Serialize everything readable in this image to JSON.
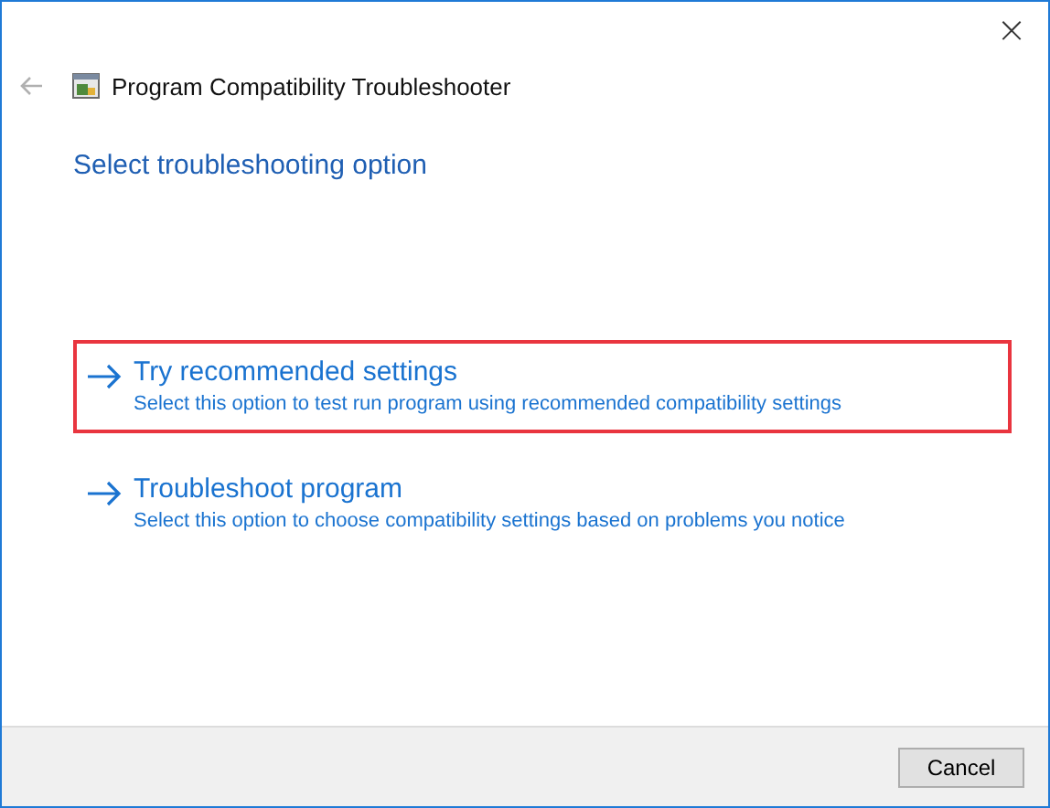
{
  "window": {
    "title": "Program Compatibility Troubleshooter",
    "close": "×"
  },
  "heading": "Select troubleshooting option",
  "options": [
    {
      "title": "Try recommended settings",
      "description": "Select this option to test run program using recommended compatibility settings",
      "highlighted": true
    },
    {
      "title": "Troubleshoot program",
      "description": "Select this option to choose compatibility settings based on problems you notice",
      "highlighted": false
    }
  ],
  "buttons": [
    "Cancel"
  ]
}
